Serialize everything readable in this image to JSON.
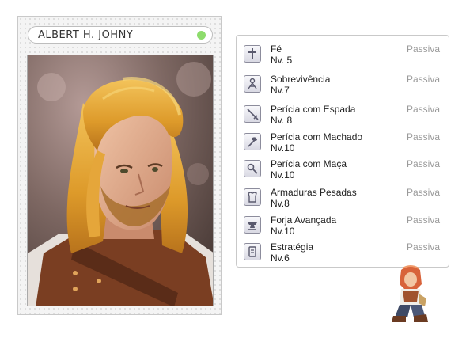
{
  "character": {
    "name": "ALBERT H. JOHNY",
    "status_color": "#8ddc6c"
  },
  "skills": [
    {
      "name": "Fé",
      "level": "Nv. 5",
      "type": "Passiva",
      "icon": "cross-icon"
    },
    {
      "name": "Sobrevivência",
      "level": "Nv.7",
      "type": "Passiva",
      "icon": "survival-icon"
    },
    {
      "name": "Perícia com Espada",
      "level": "Nv. 8",
      "type": "Passiva",
      "icon": "sword-icon"
    },
    {
      "name": "Perícia com Machado",
      "level": "Nv.10",
      "type": "Passiva",
      "icon": "axe-icon"
    },
    {
      "name": "Perícia com Maça",
      "level": "Nv.10",
      "type": "Passiva",
      "icon": "mace-icon"
    },
    {
      "name": "Armaduras Pesadas",
      "level": "Nv.8",
      "type": "Passiva",
      "icon": "armor-icon"
    },
    {
      "name": "Forja Avançada",
      "level": "Nv.10",
      "type": "Passiva",
      "icon": "anvil-icon"
    },
    {
      "name": "Estratégia",
      "level": "Nv.6",
      "type": "Passiva",
      "icon": "strategy-icon"
    }
  ]
}
